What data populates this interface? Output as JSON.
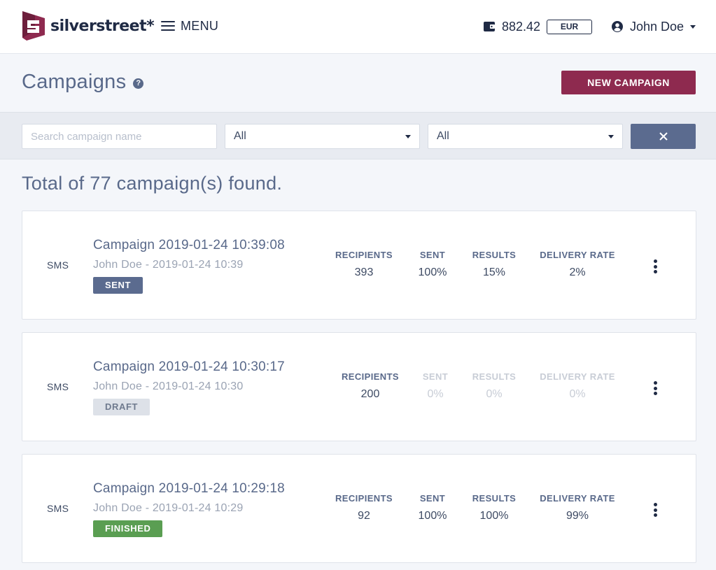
{
  "header": {
    "brand": "silverstreet*",
    "menu_label": "MENU",
    "balance": "882.42",
    "currency": "EUR",
    "user_name": "John Doe"
  },
  "page": {
    "title": "Campaigns",
    "help": "?",
    "new_campaign_label": "NEW CAMPAIGN"
  },
  "filters": {
    "search_placeholder": "Search campaign name",
    "search_value": "",
    "select_1": "All",
    "select_2": "All"
  },
  "total_text": "Total of 77 campaign(s) found.",
  "stat_labels": {
    "recipients": "RECIPIENTS",
    "sent": "SENT",
    "results": "RESULTS",
    "delivery_rate": "DELIVERY RATE"
  },
  "campaigns": [
    {
      "type": "SMS",
      "title": "Campaign 2019-01-24 10:39:08",
      "subtitle": "John Doe - 2019-01-24 10:39",
      "status": "SENT",
      "recipients": "393",
      "sent": "100%",
      "results": "15%",
      "delivery_rate": "2%"
    },
    {
      "type": "SMS",
      "title": "Campaign 2019-01-24 10:30:17",
      "subtitle": "John Doe - 2019-01-24 10:30",
      "status": "DRAFT",
      "recipients": "200",
      "sent": "0%",
      "results": "0%",
      "delivery_rate": "0%"
    },
    {
      "type": "SMS",
      "title": "Campaign 2019-01-24 10:29:18",
      "subtitle": "John Doe - 2019-01-24 10:29",
      "status": "FINISHED",
      "recipients": "92",
      "sent": "100%",
      "results": "100%",
      "delivery_rate": "99%"
    }
  ],
  "colors": {
    "brand": "#8e2a4f",
    "status_sent": "#5b6b8f",
    "status_draft": "#dde1e8",
    "status_finished": "#5a9e52"
  }
}
